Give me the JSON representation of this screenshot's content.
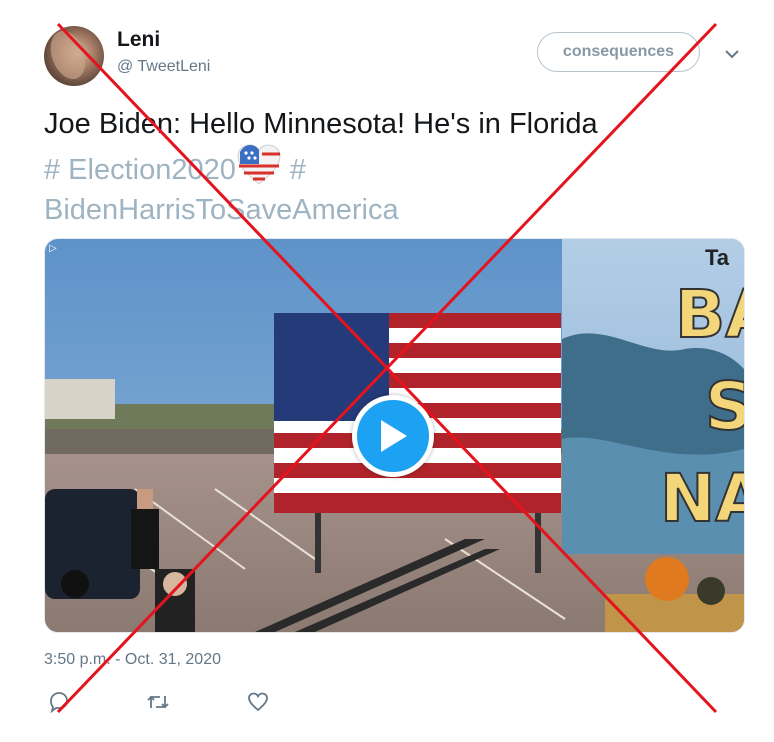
{
  "author": {
    "display_name": "Leni",
    "handle": "@ TweetLeni"
  },
  "follow_button_label": "consequences",
  "tweet": {
    "text_line": "Joe Biden: Hello Minnesota! He's in Florida",
    "hashtag_1": "# Election2020",
    "hashtag_sep": " #",
    "hashtag_2": "BidenHarrisToSaveAmerica"
  },
  "media": {
    "sign_text": [
      "Ta",
      "BA",
      "S",
      "NA"
    ],
    "play_icon": "play-icon"
  },
  "timestamp": "3:50 p.m. - Oct. 31, 2020",
  "actions": [
    "reply-icon",
    "retweet-icon",
    "like-icon"
  ],
  "overlay": {
    "cross_color": "#e5131d"
  },
  "colors": {
    "accent": "#1da1f2",
    "hashtag": "#9fb4c3",
    "muted": "#657786"
  }
}
